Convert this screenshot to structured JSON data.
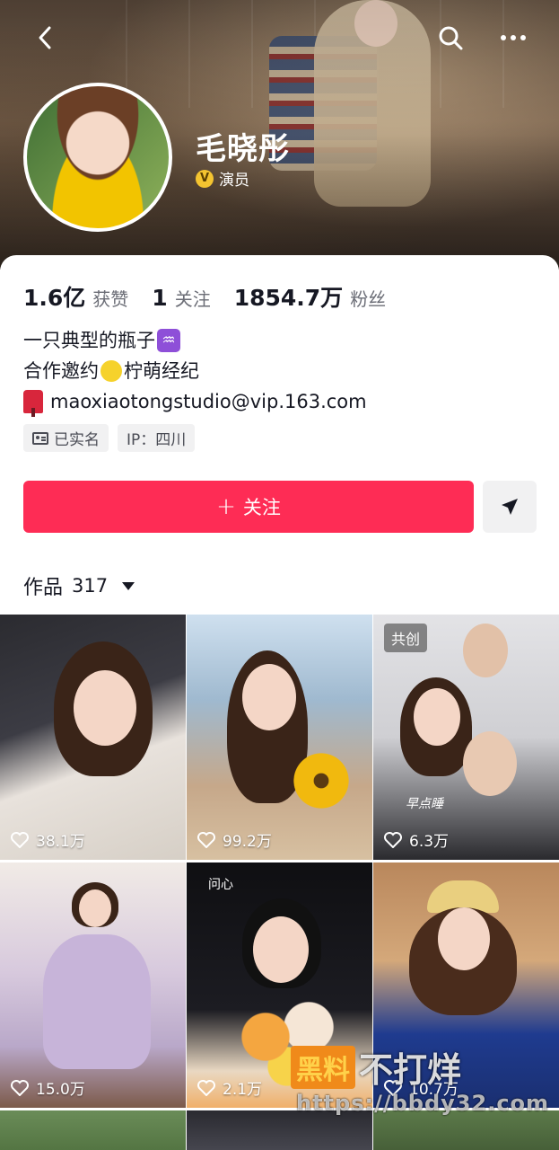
{
  "header": {
    "back_icon": "chevron-left-icon",
    "search_icon": "search-icon",
    "more_icon": "more-horizontal-icon"
  },
  "profile": {
    "name": "毛晓彤",
    "verify_badge": "V",
    "verify_label": "演员"
  },
  "stats": [
    {
      "value": "1.6亿",
      "label": "获赞"
    },
    {
      "value": "1",
      "label": "关注"
    },
    {
      "value": "1854.7万",
      "label": "粉丝"
    }
  ],
  "bio": {
    "line1": "一只典型的瓶子",
    "line2_a": "合作邀约",
    "line2_b": "柠萌经纪",
    "line3": "maoxiaotongstudio@vip.163.com"
  },
  "tags": {
    "verified": "已实名",
    "ip": "IP：四川"
  },
  "actions": {
    "follow_label": "关注",
    "follow_color": "#fe2c55"
  },
  "works": {
    "title": "作品",
    "count": "317"
  },
  "videos": [
    {
      "likes": "38.1万"
    },
    {
      "likes": "99.2万"
    },
    {
      "likes": "6.3万",
      "badge": "共创",
      "overlay_text": "早点睡"
    },
    {
      "likes": "15.0万"
    },
    {
      "likes": "2.1万",
      "overlay_text": "问心"
    },
    {
      "likes": "10.7万"
    }
  ],
  "watermark": {
    "box": "黑料",
    "text": "不打烊",
    "url": "https://bbdy32.com"
  }
}
